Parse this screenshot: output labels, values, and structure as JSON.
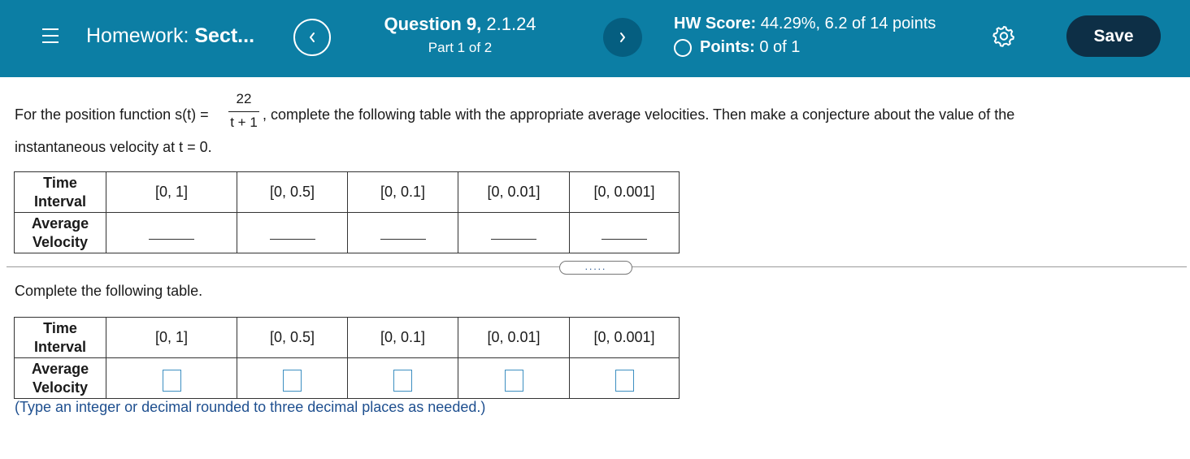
{
  "header": {
    "hw_label": "Homework:",
    "hw_name": "Sect...",
    "question_label": "Question 9,",
    "question_id": "2.1.24",
    "part": "Part 1 of 2",
    "score_label": "HW Score:",
    "score_value": "44.29%, 6.2 of 14 points",
    "points_label": "Points:",
    "points_value": "0 of 1",
    "save_label": "Save",
    "icons": [
      "menu-icon",
      "chevron-left-icon",
      "chevron-right-icon",
      "circle-icon",
      "gear-icon"
    ],
    "colors": {
      "bar": "#0c7ea4",
      "save": "#0d2f46",
      "next": "#055e80"
    }
  },
  "prompt": {
    "before": "For the position function s(t) =",
    "frac_num": "22",
    "frac_den": "t + 1",
    "after": ", complete the following table with the appropriate average velocities. Then make a conjecture about the value of the",
    "line2": "instantaneous velocity at t = 0."
  },
  "table1": {
    "header_row": [
      "Time",
      "Interval"
    ],
    "intervals": [
      "[0, 1]",
      "[0, 0.5]",
      "[0, 0.1]",
      "[0, 0.01]",
      "[0, 0.001]"
    ],
    "value_row": [
      "Average",
      "Velocity"
    ]
  },
  "expand_label": ".....",
  "complete_label": "Complete the following table.",
  "table2": {
    "header_row": [
      "Time",
      "Interval"
    ],
    "intervals": [
      "[0, 1]",
      "[0, 0.5]",
      "[0, 0.1]",
      "[0, 0.01]",
      "[0, 0.001]"
    ],
    "value_row": [
      "Average",
      "Velocity"
    ],
    "answers": [
      "",
      "",
      "",
      "",
      ""
    ]
  },
  "hint": "(Type an integer or decimal rounded to three decimal places as needed.)"
}
